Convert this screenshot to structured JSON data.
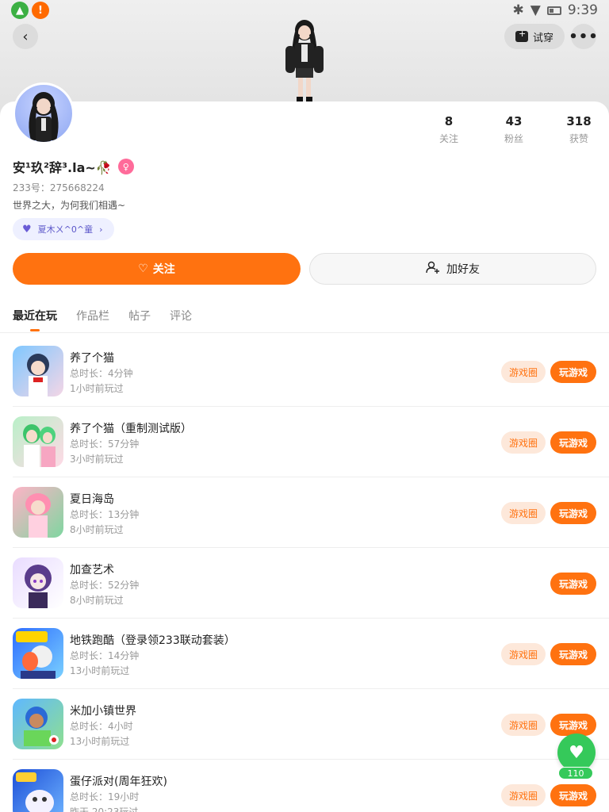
{
  "status_bar": {
    "time": "9:39",
    "left_icons": [
      "!",
      "!"
    ]
  },
  "header": {
    "tryon_label": "试穿",
    "more_label": "•••",
    "back_label": "‹"
  },
  "profile": {
    "nickname": "安¹玖²辞³.la~🥀",
    "gender_icon": "♀",
    "uid": "233号：275668224",
    "bio": "世界之大，为何我们相遇~",
    "friend_tag": "夏木ㄨ^0^童",
    "friend_tag_arrow": "›"
  },
  "stats": [
    {
      "value": "8",
      "label": "关注"
    },
    {
      "value": "43",
      "label": "粉丝"
    },
    {
      "value": "318",
      "label": "获赞"
    }
  ],
  "actions": {
    "follow": "关注",
    "add_friend": "加好友"
  },
  "tabs": [
    "最近在玩",
    "作品栏",
    "帖子",
    "评论"
  ],
  "games": [
    {
      "name": "养了个猫",
      "duration": "总时长：4分钟",
      "last_played": "1小时前玩过",
      "circle": "游戏圈",
      "play": "玩游戏"
    },
    {
      "name": "养了个猫（重制测试版）",
      "duration": "总时长：57分钟",
      "last_played": "3小时前玩过",
      "circle": "游戏圈",
      "play": "玩游戏"
    },
    {
      "name": "夏日海岛",
      "duration": "总时长：13分钟",
      "last_played": "8小时前玩过",
      "circle": "游戏圈",
      "play": "玩游戏"
    },
    {
      "name": "加查艺术",
      "duration": "总时长：52分钟",
      "last_played": "8小时前玩过",
      "circle": "",
      "play": "玩游戏"
    },
    {
      "name": "地铁跑酷（登录领233联动套装）",
      "duration": "总时长：14分钟",
      "last_played": "13小时前玩过",
      "circle": "游戏圈",
      "play": "玩游戏"
    },
    {
      "name": "米加小镇世界",
      "duration": "总时长：4小时",
      "last_played": "13小时前玩过",
      "circle": "游戏圈",
      "play": "玩游戏"
    },
    {
      "name": "蛋仔派对(周年狂欢)",
      "duration": "总时长：19小时",
      "last_played": "昨天 20:23玩过",
      "circle": "游戏圈",
      "play": "玩游戏"
    }
  ],
  "like_fab": {
    "icon": "♥",
    "count": "110"
  },
  "colors": {
    "accent": "#ff7210",
    "like_green": "#35c95a",
    "chip_bg": "#fde8da"
  }
}
